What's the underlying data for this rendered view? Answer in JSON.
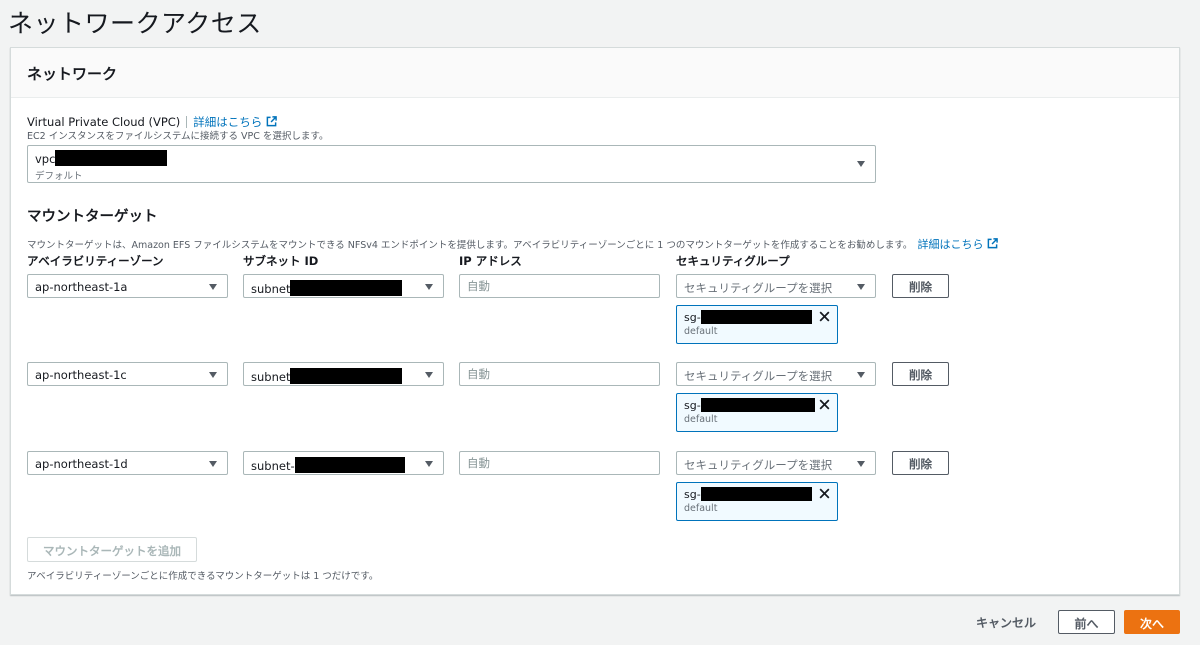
{
  "page": {
    "title": "ネットワークアクセス"
  },
  "network": {
    "header": "ネットワーク",
    "vpc_label": "Virtual Private Cloud (VPC)",
    "vpc_info_link": "詳細はこちら",
    "vpc_desc": "EC2 インスタンスをファイルシステムに接続する VPC を選択します。",
    "vpc_value": "vpc",
    "vpc_sub": "デフォルト"
  },
  "mount": {
    "title": "マウントターゲット",
    "desc": "マウントターゲットは、Amazon EFS ファイルシステムをマウントできる NFSv4 エンドポイントを提供します。アベイラビリティーゾーンごとに 1 つのマウントターゲットを作成することをお勧めします。",
    "info_link": "詳細はこちら",
    "columns": {
      "az": "アベイラビリティーゾーン",
      "subnet": "サブネット ID",
      "ip": "IP アドレス",
      "sg": "セキュリティグループ"
    },
    "rows": [
      {
        "az": "ap-northeast-1a",
        "subnet": "subnet",
        "ip_placeholder": "自動",
        "sg_placeholder": "セキュリティグループを選択",
        "remove": "削除",
        "sg_id": "sg-",
        "sg_name": "default"
      },
      {
        "az": "ap-northeast-1c",
        "subnet": "subnet",
        "ip_placeholder": "自動",
        "sg_placeholder": "セキュリティグループを選択",
        "remove": "削除",
        "sg_id": "sg-",
        "sg_name": "default"
      },
      {
        "az": "ap-northeast-1d",
        "subnet": "subnet-",
        "ip_placeholder": "自動",
        "sg_placeholder": "セキュリティグループを選択",
        "remove": "削除",
        "sg_id": "sg-",
        "sg_name": "default"
      }
    ],
    "add_button": "マウントターゲットを追加",
    "add_note": "アベイラビリティーゾーンごとに作成できるマウントターゲットは 1 つだけです。"
  },
  "footer": {
    "cancel": "キャンセル",
    "back": "前へ",
    "next": "次へ"
  },
  "colors": {
    "accent": "#ec7211",
    "link": "#0073bb",
    "token_border": "#0073bb"
  },
  "icons": [
    "external-link-icon",
    "chevron-down-icon",
    "close-icon"
  ]
}
